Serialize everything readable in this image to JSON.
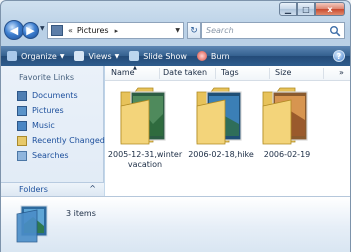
{
  "window": {
    "caption_buttons": {
      "minimize_icon": "minimize-icon",
      "maximize_icon": "maximize-icon",
      "close_glyph": "x"
    }
  },
  "address_bar": {
    "overflow": "«",
    "location": "Pictures",
    "chevron": "▸"
  },
  "search": {
    "placeholder": "Search"
  },
  "toolbar": {
    "organize": "Organize",
    "views": "Views",
    "slide_show": "Slide Show",
    "burn": "Burn",
    "help": "?"
  },
  "nav_pane": {
    "heading": "Favorite Links",
    "items": [
      {
        "label": "Documents"
      },
      {
        "label": "Pictures"
      },
      {
        "label": "Music"
      },
      {
        "label": "Recently Changed"
      },
      {
        "label": "Searches"
      }
    ],
    "folders_label": "Folders",
    "folders_chevron": "^"
  },
  "columns": [
    "Name",
    "Date taken",
    "Tags",
    "Size"
  ],
  "column_overflow": "»",
  "files": [
    {
      "name": "2005-12-31,winter vacation"
    },
    {
      "name": "2006-02-18,hike"
    },
    {
      "name": "2006-02-19"
    }
  ],
  "details": {
    "count": "3 items"
  },
  "colors": {
    "toolbar": "#2e5c8d",
    "link": "#1c4f9c",
    "folder": "#e8c55c"
  }
}
